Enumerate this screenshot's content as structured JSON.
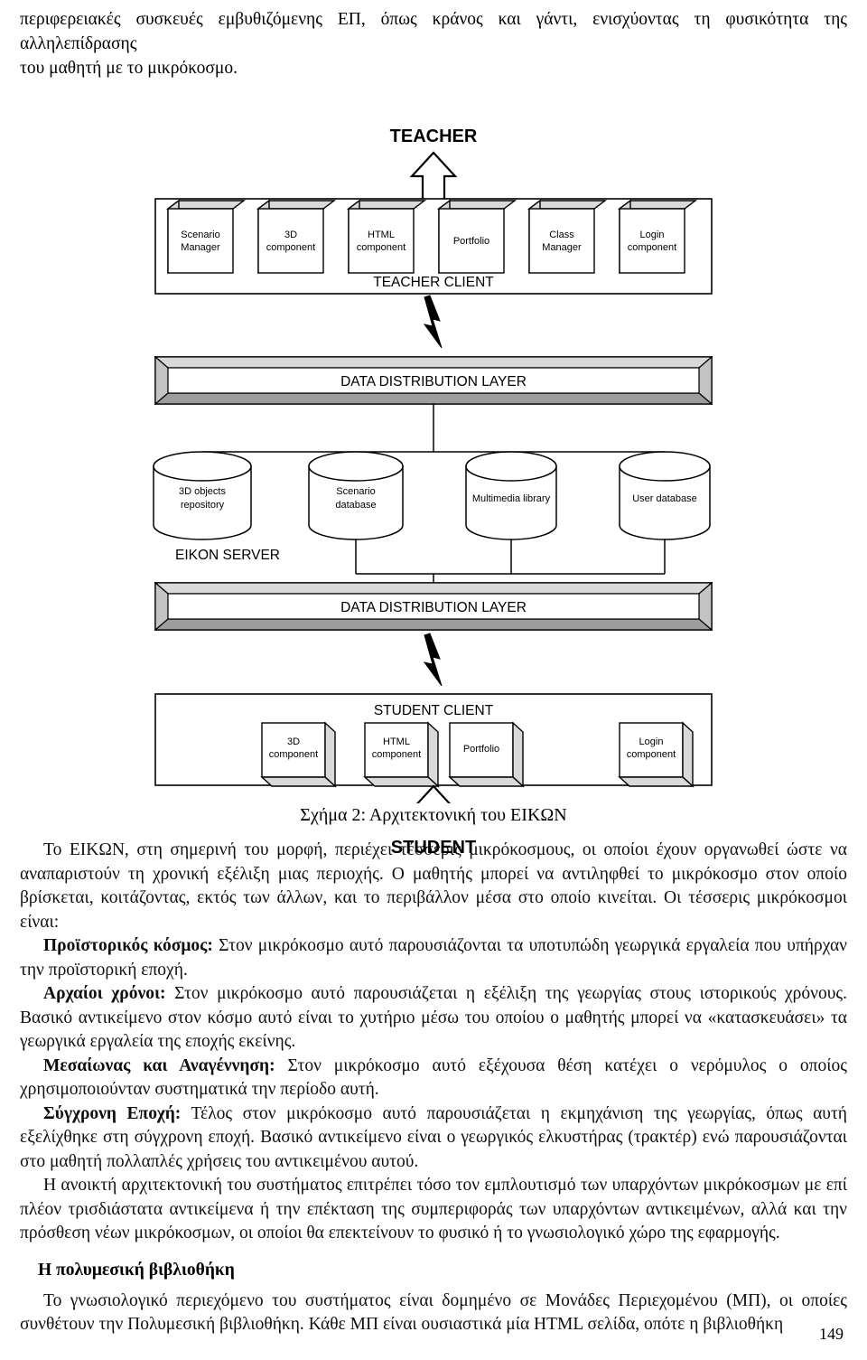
{
  "page": {
    "number": "149"
  },
  "top_text": {
    "line1": "περιφερειακές συσκευές εμβυθιζόμενης ΕΠ, όπως κράνος και γάντι, ενισχύοντας τη φυσικότητα της αλληλεπίδρασης",
    "line2": "του μαθητή με το μικρόκοσμο."
  },
  "figure": {
    "top_actor": "TEACHER",
    "bottom_actor": "STUDENT",
    "teacher_client_label": "TEACHER CLIENT",
    "student_client_label": "STUDENT CLIENT",
    "server_label": "EIKON SERVER",
    "ddl_top_label": "DATA DISTRIBUTION LAYER",
    "ddl_bottom_label": "DATA DISTRIBUTION LAYER",
    "teacher_components": [
      {
        "line1": "Scenario",
        "line2": "Manager"
      },
      {
        "line1": "3D",
        "line2": "component"
      },
      {
        "line1": "HTML",
        "line2": "component"
      },
      {
        "line1": "Portfolio",
        "line2": ""
      },
      {
        "line1": "Class",
        "line2": "Manager"
      },
      {
        "line1": "Login",
        "line2": "component"
      }
    ],
    "student_components": [
      {
        "line1": "3D",
        "line2": "component"
      },
      {
        "line1": "HTML",
        "line2": "component"
      },
      {
        "line1": "Portfolio",
        "line2": ""
      },
      {
        "line1": "Login",
        "line2": "component"
      }
    ],
    "databases": [
      {
        "line1": "3D objects",
        "line2": "repository"
      },
      {
        "line1": "Scenario",
        "line2": "database"
      },
      {
        "line1": "Multimedia library",
        "line2": ""
      },
      {
        "line1": "User database",
        "line2": ""
      }
    ],
    "colors": {
      "box_face": "#ffffff",
      "box_shade_light": "#d9d9d9",
      "box_shade_dark": "#9d9d9d",
      "stroke": "#000000"
    }
  },
  "caption": "Σχήμα 2: Αρχιτεκτονική του ΕΙΚΩΝ",
  "body": {
    "p1": "Το ΕΙΚΩΝ, στη σημερινή του μορφή, περιέχει τέσσερις μικρόκοσμους, οι οποίοι έχουν οργανωθεί ώστε να αναπαριστούν τη χρονική εξέλιξη μιας περιοχής. Ο μαθητής μπορεί να αντιληφθεί το μικρόκοσμο στον οποίο βρίσκεται, κοιτάζοντας, εκτός των άλλων, και το περιβάλλον μέσα στο οποίο κινείται. Οι τέσσερις μικρόκοσμοι είναι:",
    "p2_bold": "Προϊστορικός κόσμος:",
    "p2_rest": " Στον μικρόκοσμο αυτό παρουσιάζονται τα υποτυπώδη γεωργικά εργαλεία που υπήρχαν την προϊστορική εποχή.",
    "p3_bold": "Αρχαίοι χρόνοι:",
    "p3_rest": " Στον μικρόκοσμο αυτό παρουσιάζεται η εξέλιξη της γεωργίας στους ιστορικούς χρόνους. Βασικό αντικείμενο στον κόσμο αυτό είναι το χυτήριο μέσω του οποίου ο μαθητής μπορεί να «κατασκευάσει» τα γεωργικά εργαλεία της εποχής εκείνης.",
    "p4_bold": "Μεσαίωνας και Αναγέννηση:",
    "p4_rest": " Στον μικρόκοσμο αυτό εξέχουσα θέση κατέχει ο νερόμυλος ο οποίος χρησιμοποιούνταν συστηματικά την περίοδο αυτή.",
    "p5_bold": "Σύγχρονη Εποχή:",
    "p5_rest": " Τέλος στον μικρόκοσμο αυτό παρουσιάζεται η εκμηχάνιση της γεωργίας, όπως αυτή εξελίχθηκε στη σύγχρονη εποχή. Βασικό αντικείμενο είναι ο γεωργικός ελκυστήρας (τρακτέρ) ενώ παρουσιάζονται στο μαθητή πολλαπλές χρήσεις του αντικειμένου αυτού.",
    "p6": "Η ανοικτή αρχιτεκτονική του συστήματος επιτρέπει τόσο τον εμπλουτισμό των υπαρχόντων μικρόκοσμων με επί πλέον τρισδιάστατα αντικείμενα ή την επέκταση της συμπεριφοράς των υπαρχόντων αντικειμένων, αλλά και την πρόσθεση νέων μικρόκοσμων, οι οποίοι θα επεκτείνουν το φυσικό ή το γνωσιολογικό χώρο της εφαρμογής.",
    "heading": "Η πολυμεσική βιβλιοθήκη",
    "p7": "Το γνωσιολογικό περιεχόμενο του συστήματος είναι δομημένο σε Μονάδες Περιεχομένου (ΜΠ), οι οποίες συνθέτουν την Πολυμεσική βιβλιοθήκη. Κάθε ΜΠ είναι ουσιαστικά μία HTML σελίδα, οπότε η βιβλιοθήκη"
  }
}
